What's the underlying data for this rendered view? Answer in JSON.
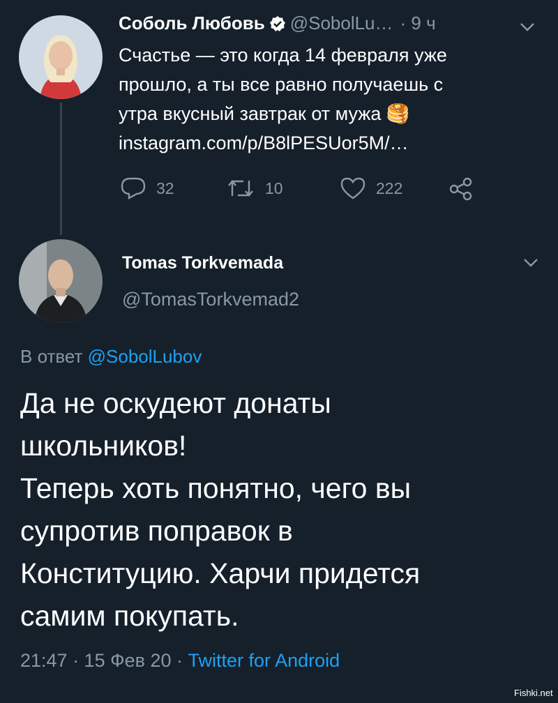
{
  "original_tweet": {
    "author_name": "Соболь Любовь",
    "handle": "@SobolLu…",
    "time": "· 9 ч",
    "text_lines": [
      "Счастье — это когда 14 февраля уже",
      "прошло, а ты все равно получаешь с",
      "утра вкусный завтрак от мужа 🥞"
    ],
    "link": "instagram.com/p/B8lPESUor5M/…",
    "replies": "32",
    "retweets": "10",
    "likes": "222"
  },
  "reply_tweet": {
    "author_name": "Tomas Torkvemada",
    "handle": "@TomasTorkvemad2",
    "in_reply_prefix": "В ответ",
    "in_reply_handle": "@SobolLubov",
    "text_lines": [
      "Да не оскудеют донаты",
      "школьников!",
      "Теперь хоть понятно, чего вы",
      "супротив поправок в",
      "Конституцию. Харчи придется",
      "самим покупать."
    ],
    "timestamp": "21:47 · 15 Фев 20 ·",
    "source": "Twitter for Android"
  },
  "watermark": "Fishki.net",
  "colors": {
    "background": "#15202b",
    "link": "#1da1f2",
    "muted": "#8899a6",
    "text": "#ffffff"
  }
}
